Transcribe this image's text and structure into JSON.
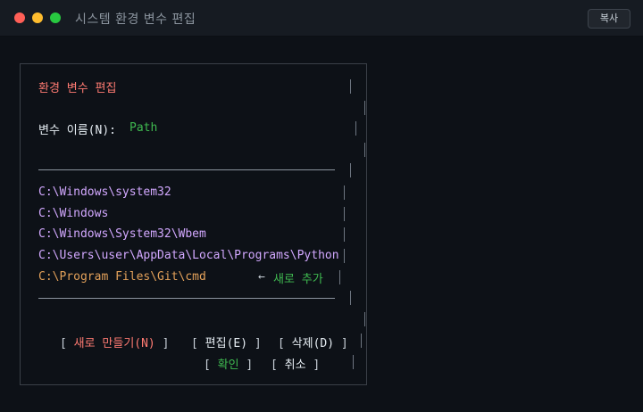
{
  "window": {
    "title": "시스템 환경 변수 편집",
    "copy_label": "복사"
  },
  "dialog": {
    "heading": "환경 변수 편집",
    "name_label": "변수 이름(N):",
    "name_value": "Path",
    "paths": [
      "C:\\Windows\\system32",
      "C:\\Windows",
      "C:\\Windows\\System32\\Wbem",
      "C:\\Users\\user\\AppData\\Local\\Programs\\Python",
      "C:\\Program Files\\Git\\cmd"
    ],
    "new_item_arrow": "←",
    "new_item_note": "새로 추가",
    "buttons": {
      "new": "새로 만들기(N)",
      "edit": "편집(E)",
      "delete": "삭제(D)",
      "ok": "확인",
      "cancel": "취소"
    }
  },
  "colors": {
    "accent_red": "#ff7b72",
    "accent_green": "#3fb950",
    "path_purple": "#d2a8ff",
    "highlight_orange": "#e3a15a"
  }
}
